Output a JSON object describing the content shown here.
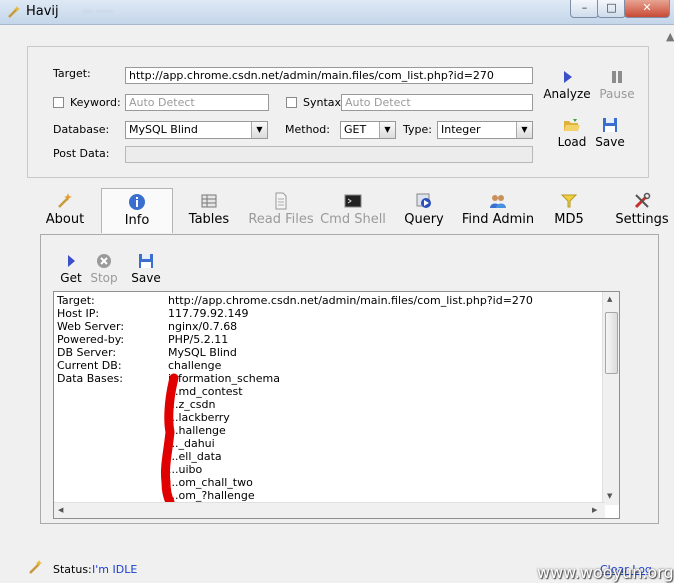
{
  "window": {
    "title": "Havij",
    "blurred_title": "··· ·····"
  },
  "form": {
    "target_label": "Target:",
    "target_value": "http://app.chrome.csdn.net/admin/main.files/com_list.php?id=270",
    "keyword_label": "Keyword:",
    "keyword_placeholder": "Auto Detect",
    "syntax_label": "Syntax:",
    "syntax_placeholder": "Auto Detect",
    "database_label": "Database:",
    "database_value": "MySQL Blind",
    "method_label": "Method:",
    "method_value": "GET",
    "type_label": "Type:",
    "type_value": "Integer",
    "postdata_label": "Post Data:",
    "postdata_value": ""
  },
  "side_buttons": {
    "analyze": "Analyze",
    "pause": "Pause",
    "load": "Load",
    "save": "Save"
  },
  "tabs": [
    {
      "label": "About",
      "icon": "wand-icon"
    },
    {
      "label": "Info",
      "icon": "info-icon"
    },
    {
      "label": "Tables",
      "icon": "table-icon"
    },
    {
      "label": "Read Files",
      "icon": "file-icon"
    },
    {
      "label": "Cmd Shell",
      "icon": "terminal-icon"
    },
    {
      "label": "Query",
      "icon": "query-icon"
    },
    {
      "label": "Find Admin",
      "icon": "users-icon"
    },
    {
      "label": "MD5",
      "icon": "key-icon"
    },
    {
      "label": "Settings",
      "icon": "tools-icon"
    }
  ],
  "info_toolbar": {
    "get": "Get",
    "stop": "Stop",
    "save": "Save"
  },
  "info": {
    "rows": [
      {
        "key": "Target:",
        "value": "http://app.chrome.csdn.net/admin/main.files/com_list.php?id=270"
      },
      {
        "key": "Host IP:",
        "value": "117.79.92.149"
      },
      {
        "key": "Web Server:",
        "value": "nginx/0.7.68"
      },
      {
        "key": "Powered-by:",
        "value": "PHP/5.2.11"
      },
      {
        "key": "DB Server:",
        "value": "MySQL Blind"
      },
      {
        "key": "Current DB:",
        "value": "challenge"
      },
      {
        "key": "Data Bases:",
        "value": "information_schema"
      }
    ],
    "databases": [
      "...md_contest",
      "...z_csdn",
      "...lackberry",
      "...hallenge",
      "..._dahui",
      "...ell_data",
      "...uibo",
      "...om_chall_two",
      "...om_?hallenge"
    ]
  },
  "status": {
    "label": "Status:",
    "value": "I'm IDLE",
    "clear_log": "Clear Log"
  },
  "watermark": "www.wooyun.org",
  "colors": {
    "accent": "#1a3ecc",
    "redaction": "#e00000"
  }
}
